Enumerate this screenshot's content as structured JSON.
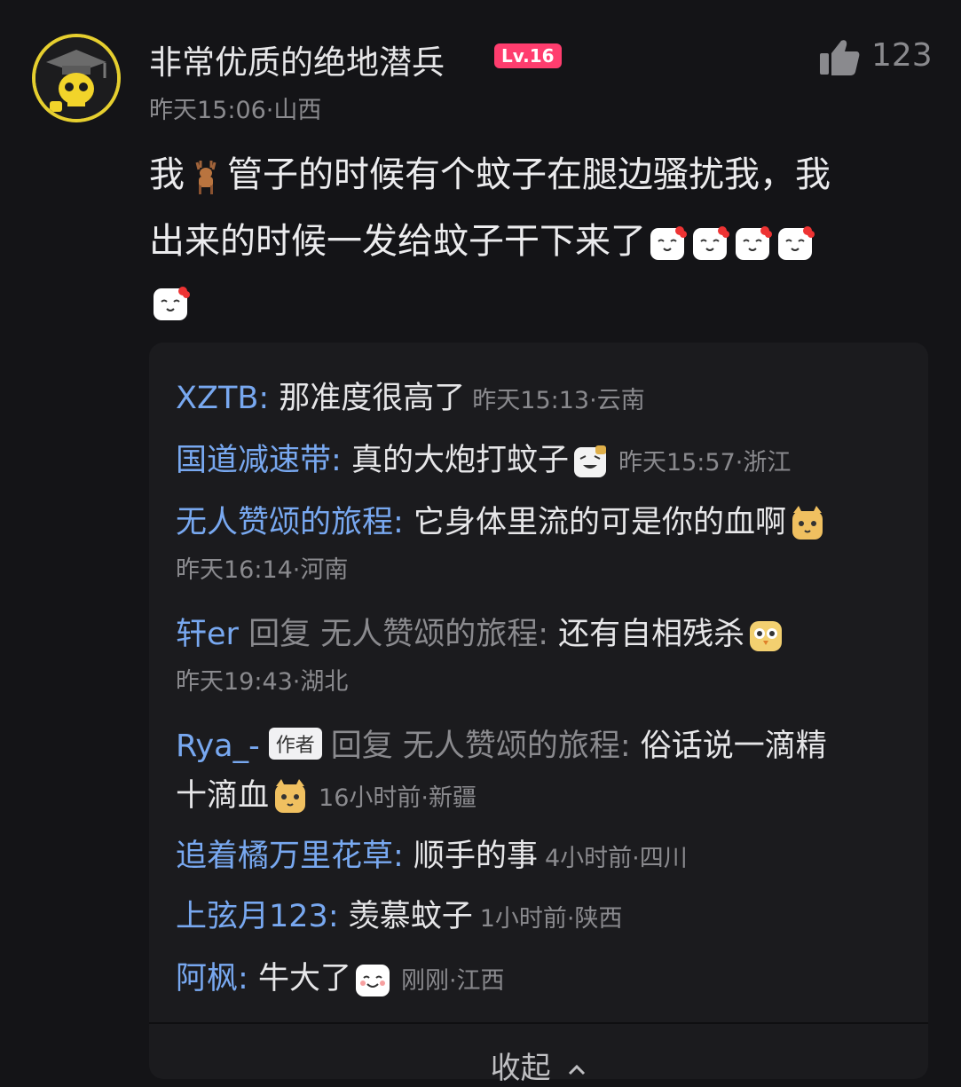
{
  "comment": {
    "author": "非常优质的绝地潜兵",
    "level": "Lv.16",
    "likes": "123",
    "time_location": "昨天15:06·山西",
    "text_part1": "我",
    "text_part2": "管子的时候有个蚊子在腿边骚扰我，我",
    "text_line2": "出来的时候一发给蚊子干下来了"
  },
  "replies": [
    {
      "user": "XZTB",
      "sep": ": ",
      "text": "那准度很高了",
      "meta": "昨天15:13·云南"
    },
    {
      "user": "国道减速带",
      "sep": ": ",
      "text": "真的大炮打蚊子",
      "meta": "昨天15:57·浙江"
    },
    {
      "user": "无人赞颂的旅程",
      "sep": ": ",
      "text": "它身体里流的可是你的血啊",
      "meta": "昨天16:14·河南"
    },
    {
      "user": "轩er",
      "reply_word": " 回复 ",
      "target": "无人赞颂的旅程",
      "sep": ": ",
      "text": "还有自相残杀",
      "meta": "昨天19:43·湖北"
    },
    {
      "user": "Rya_-",
      "badge": "作者",
      "reply_word": "回复 ",
      "target": "无人赞颂的旅程",
      "sep": ": ",
      "text": "俗话说一滴精",
      "text_line2": "十滴血",
      "meta": "16小时前·新疆"
    },
    {
      "user": "追着橘万里花草",
      "sep": ": ",
      "text": "顺手的事",
      "meta": "4小时前·四川"
    },
    {
      "user": "上弦月123",
      "sep": ": ",
      "text": "羡慕蚊子",
      "meta": "1小时前·陕西"
    },
    {
      "user": "阿枫",
      "sep": ": ",
      "text": "牛大了",
      "meta": "刚刚·江西"
    }
  ],
  "collapse_label": "收起",
  "colors": {
    "background": "#141417",
    "panel": "#1b1b1e",
    "username": "#78a8f0",
    "level_badge": "#ff3d6e",
    "avatar_ring": "#e6cf2f"
  },
  "icons": [
    "thumbs-up-icon",
    "deer-emoji-icon",
    "blush-face-emoji-icon",
    "laughing-emoji-icon",
    "cat-emoji-icon",
    "chick-emoji-icon",
    "chevron-up-icon"
  ]
}
